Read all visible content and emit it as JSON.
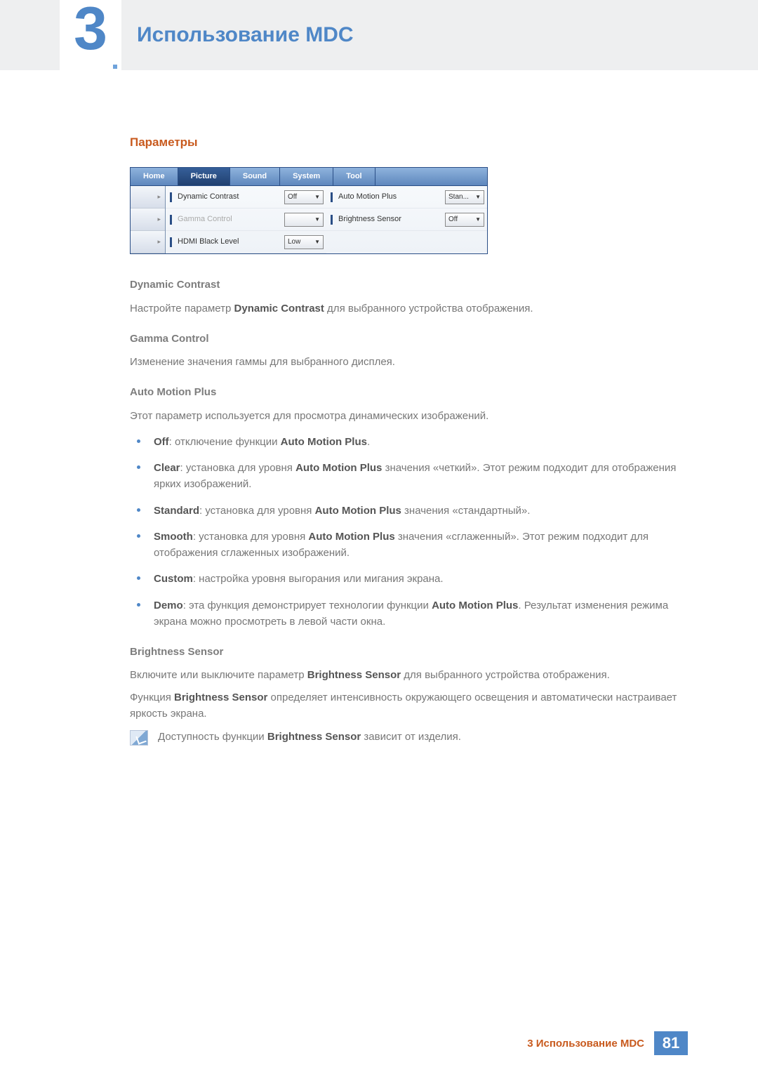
{
  "header": {
    "chapter_number": "3",
    "title": "Использование MDC"
  },
  "section_title": "Параметры",
  "panel": {
    "tabs": [
      "Home",
      "Picture",
      "Sound",
      "System",
      "Tool"
    ],
    "active_tab_index": 1,
    "left_arrows": [
      "▸",
      "▸",
      "▸"
    ],
    "rows_left": [
      {
        "label": "Dynamic Contrast",
        "value": "Off",
        "disabled": false
      },
      {
        "label": "Gamma Control",
        "value": "",
        "disabled": true
      },
      {
        "label": "HDMI Black Level",
        "value": "Low",
        "disabled": false
      }
    ],
    "rows_right": [
      {
        "label": "Auto Motion Plus",
        "value": "Stan...",
        "disabled": false
      },
      {
        "label": "Brightness Sensor",
        "value": "Off",
        "disabled": false
      }
    ]
  },
  "sections": {
    "dc": {
      "heading": "Dynamic Contrast",
      "text_pre": "Настройте параметр ",
      "text_bold": "Dynamic Contrast",
      "text_post": " для выбранного устройства отображения."
    },
    "gc": {
      "heading": "Gamma Control",
      "text": "Изменение значения гаммы для выбранного дисплея."
    },
    "amp": {
      "heading": "Auto Motion Plus",
      "intro": "Этот параметр используется для просмотра динамических изображений.",
      "items": [
        {
          "b": "Off",
          "mid": ": отключение функции ",
          "b2": "Auto Motion Plus",
          "post": "."
        },
        {
          "b": "Clear",
          "mid": ": установка для уровня ",
          "b2": "Auto Motion Plus",
          "post": " значения «четкий». Этот режим подходит для отображения ярких изображений."
        },
        {
          "b": "Standard",
          "mid": ": установка для уровня ",
          "b2": "Auto Motion Plus",
          "post": " значения «стандартный»."
        },
        {
          "b": "Smooth",
          "mid": ": установка для уровня ",
          "b2": "Auto Motion Plus",
          "post": " значения «сглаженный». Этот режим подходит для отображения сглаженных изображений."
        },
        {
          "b": "Custom",
          "mid": ": настройка уровня выгорания или мигания экрана.",
          "b2": "",
          "post": ""
        },
        {
          "b": "Demo",
          "mid": ": эта функция демонстрирует технологии функции ",
          "b2": "Auto Motion Plus",
          "post": ". Результат изменения режима экрана можно просмотреть в левой части окна."
        }
      ]
    },
    "bs": {
      "heading": "Brightness Sensor",
      "p1_pre": "Включите или выключите параметр ",
      "p1_bold": "Brightness Sensor",
      "p1_post": " для выбранного устройства отображения.",
      "p2_pre": "Функция ",
      "p2_bold": "Brightness Sensor",
      "p2_post": " определяет интенсивность окружающего освещения и автоматически настраивает яркость экрана.",
      "note_pre": "Доступность функции ",
      "note_bold": "Brightness Sensor",
      "note_post": " зависит от изделия."
    }
  },
  "footer": {
    "text": "3 Использование MDC",
    "page": "81"
  }
}
